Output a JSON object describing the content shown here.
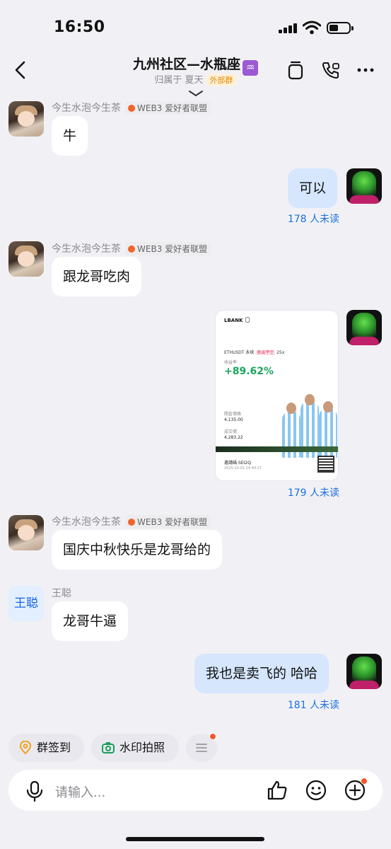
{
  "status_bar": {
    "time": "16:50"
  },
  "header": {
    "title": "九州社区—水瓶座",
    "title_emoji": "♒",
    "subtitle_prefix": "归属于 夏天",
    "ext_tag": "外部群"
  },
  "group_badge": "WEB3 爱好者联盟",
  "messages": [
    {
      "sender": "今生水泡今生茶",
      "text": "牛"
    },
    {
      "text": "可以",
      "unread": "178 人未读"
    },
    {
      "sender": "今生水泡今生茶",
      "text": "跟龙哥吃肉"
    },
    {
      "image": {
        "logo": "LBANK",
        "pair": "ETHUSDT 永续",
        "side": "卖出平空",
        "leverage": "25x",
        "pnl_label": "收益率",
        "pnl": "+89.62%",
        "open_label": "開倉價格",
        "open_price": "4,135.00",
        "close_label": "成交價",
        "close_price": "4,283.22",
        "invite": "邀請碼:SEI2Q",
        "date": "2025-10-01 14:44:27"
      },
      "unread": "179 人未读"
    },
    {
      "sender": "今生水泡今生茶",
      "text": "国庆中秋快乐是龙哥给的"
    },
    {
      "sender": "王聪",
      "avatar_text": "王聪",
      "text": "龙哥牛逼"
    },
    {
      "text": "我也是卖飞的 哈哈",
      "unread": "181 人未读"
    }
  ],
  "quick_actions": [
    {
      "label": "群签到"
    },
    {
      "label": "水印拍照"
    }
  ],
  "input": {
    "placeholder": "请输入..."
  },
  "colors": {
    "accent": "#1b6fe0",
    "out_bubble": "#d5e6fd",
    "badge_dot": "#f25a2c",
    "pnl_green": "#1ba55d"
  }
}
